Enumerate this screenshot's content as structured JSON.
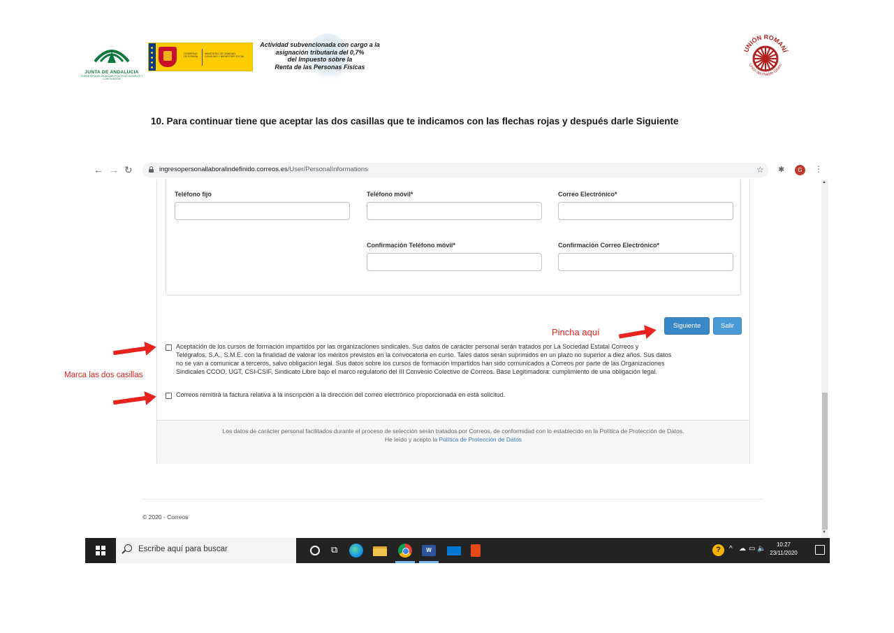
{
  "header": {
    "junta": {
      "name": "JUNTA DE ANDALUCIA",
      "sub": "CONSEJERÍA DE IGUALDAD, POLÍTICAS SOCIALES Y CONCILIACIÓN"
    },
    "gobierno": {
      "gobierno_text": "GOBIERNO DE ESPAÑA",
      "ministerio_text": "MINISTERIO DE SANIDAD, CONSUMO Y BIENESTAR SOCIAL"
    },
    "subsidy_lines": [
      "Actividad subvencionada con cargo a la",
      "asignación tributaria del 0,7%",
      "del Impuesto sobre la",
      "Renta de las Personas Físicas"
    ],
    "romani": {
      "top_text": "UNIÓN ROMANÍ",
      "bottom_text": "Unión del Pueblo Gitano"
    }
  },
  "instruction": "10. Para continuar tiene que aceptar las dos casillas que te indicamos con las flechas rojas y después darle Siguiente",
  "browser": {
    "url_host": "ingresopersonallaboralindefinido.correos.es",
    "url_path": "/User/PersonalInformations",
    "avatar_letter": "G"
  },
  "form": {
    "telefono_fijo": "Teléfono fijo",
    "telefono_movil": "Teléfono móvil*",
    "correo": "Correo Electrónico*",
    "confirm_movil": "Confirmación Teléfono móvil*",
    "confirm_correo": "Confirmación Correo Electrónico*",
    "values": {
      "telefono_fijo": "",
      "telefono_movil": "",
      "correo": "",
      "confirm_movil": "",
      "confirm_correo": ""
    }
  },
  "buttons": {
    "siguiente": "Siguiente",
    "salir": "Salir"
  },
  "checkboxes": [
    {
      "checked": false,
      "lines": [
        "Aceptación de los cursos de formación impartidos por las organizaciones sindicales. Sus datos de carácter personal serán tratados por La Sociedad Estatal Correos y",
        "Telégrafos, S.A., S.M.E. con la finalidad de valorar los méritos previstos en la convocatoria en curso. Tales datos serán suprimidos en un plazo no superior a diez años. Sus datos",
        "no se van a comunicar a terceros, salvo obligación legal. Sus datos sobre los cursos de formación impartidos han sido comunicados a Correos por parte de las Organizaciones",
        "Sindicales CCOO, UGT, CSI-CSIF, Sindicato Libre bajo el marco regulatorio del III Convenio Colectivo de Correos. Base Legitimadora: cumplimiento de una obligación legal."
      ]
    },
    {
      "checked": false,
      "lines": [
        "Correos remitirá la factura relativa a la inscripción a la dirección del correo electrónico proporcionada en esta solicitud."
      ]
    }
  ],
  "privacy": {
    "line1": "Los datos de carácter personal facilitados durante el proceso de selección serán tratados por Correos, de conformidad con lo establecido en la Política de Protección de Datos.",
    "line2_prefix": "He leído y acepto la ",
    "line2_link": "Política de Protección de Datos"
  },
  "copyright": "© 2020 - Correos",
  "annotations": {
    "pincha": "Pincha aquí",
    "marca": "Marca las dos casillas"
  },
  "taskbar": {
    "search_placeholder": "Escribe aquí para buscar",
    "time": "10:27",
    "date": "23/11/2020",
    "word_letter": "W"
  },
  "colors": {
    "annotation_red": "#e8231e",
    "button_blue": "#3a87c8",
    "link_blue": "#3a7bbf",
    "junta_green": "#0a7a3b"
  }
}
